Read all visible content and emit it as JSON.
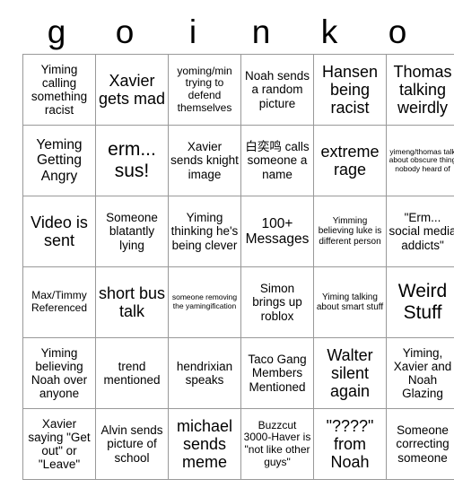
{
  "board": {
    "title_letters": [
      "g",
      "o",
      "i",
      "n",
      "k",
      "o"
    ],
    "columns": 6,
    "rows": 6,
    "border_color": "#999999",
    "text_color": "#000000",
    "background_color": "#ffffff"
  },
  "cells": [
    {
      "text": "Yiming calling something racist",
      "size": "t-md"
    },
    {
      "text": "Xavier gets mad",
      "size": "t-xl"
    },
    {
      "text": "yoming/min trying to defend themselves",
      "size": "t-sm"
    },
    {
      "text": "Noah sends a random picture",
      "size": "t-md"
    },
    {
      "text": "Hansen being racist",
      "size": "t-xl"
    },
    {
      "text": "Thomas talking weirdly",
      "size": "t-xl"
    },
    {
      "text": "Yeming Getting Angry",
      "size": "t-lg"
    },
    {
      "text": "erm... sus!",
      "size": "t-xxl"
    },
    {
      "text": "Xavier sends knight image",
      "size": "t-md"
    },
    {
      "text": "白奕鸣 calls someone a name",
      "size": "t-md"
    },
    {
      "text": "extreme rage",
      "size": "t-xl"
    },
    {
      "text": "yimeng/thomas talk about obscure thing nobody heard of",
      "size": "t-xxs"
    },
    {
      "text": "Video is sent",
      "size": "t-xl"
    },
    {
      "text": "Someone blatantly lying",
      "size": "t-md"
    },
    {
      "text": "Yiming thinking he's being clever",
      "size": "t-md"
    },
    {
      "text": "100+ Messages",
      "size": "t-lg"
    },
    {
      "text": "Yimming believing luke is different person",
      "size": "t-xs"
    },
    {
      "text": "\"Erm... social media addicts\"",
      "size": "t-md"
    },
    {
      "text": "Max/Timmy Referenced",
      "size": "t-sm"
    },
    {
      "text": "short bus talk",
      "size": "t-xl"
    },
    {
      "text": "someone removing the yamingification",
      "size": "t-xxs"
    },
    {
      "text": "Simon brings up roblox",
      "size": "t-md"
    },
    {
      "text": "Yiming talking about smart stuff",
      "size": "t-xs"
    },
    {
      "text": "Weird Stuff",
      "size": "t-xxl"
    },
    {
      "text": "Yiming believing Noah over anyone",
      "size": "t-md"
    },
    {
      "text": "trend mentioned",
      "size": "t-md"
    },
    {
      "text": "hendrixian speaks",
      "size": "t-md"
    },
    {
      "text": "Taco Gang Members Mentioned",
      "size": "t-md"
    },
    {
      "text": "Walter silent again",
      "size": "t-xl"
    },
    {
      "text": "Yiming, Xavier and Noah Glazing",
      "size": "t-md"
    },
    {
      "text": "Xavier saying \"Get out\" or \"Leave\"",
      "size": "t-md"
    },
    {
      "text": "Alvin sends picture of school",
      "size": "t-md"
    },
    {
      "text": "michael sends meme",
      "size": "t-xl"
    },
    {
      "text": "Buzzcut 3000-Haver is \"not like other guys\"",
      "size": "t-sm"
    },
    {
      "text": "\"????\" from Noah",
      "size": "t-xl"
    },
    {
      "text": "Someone correcting someone",
      "size": "t-md"
    }
  ]
}
